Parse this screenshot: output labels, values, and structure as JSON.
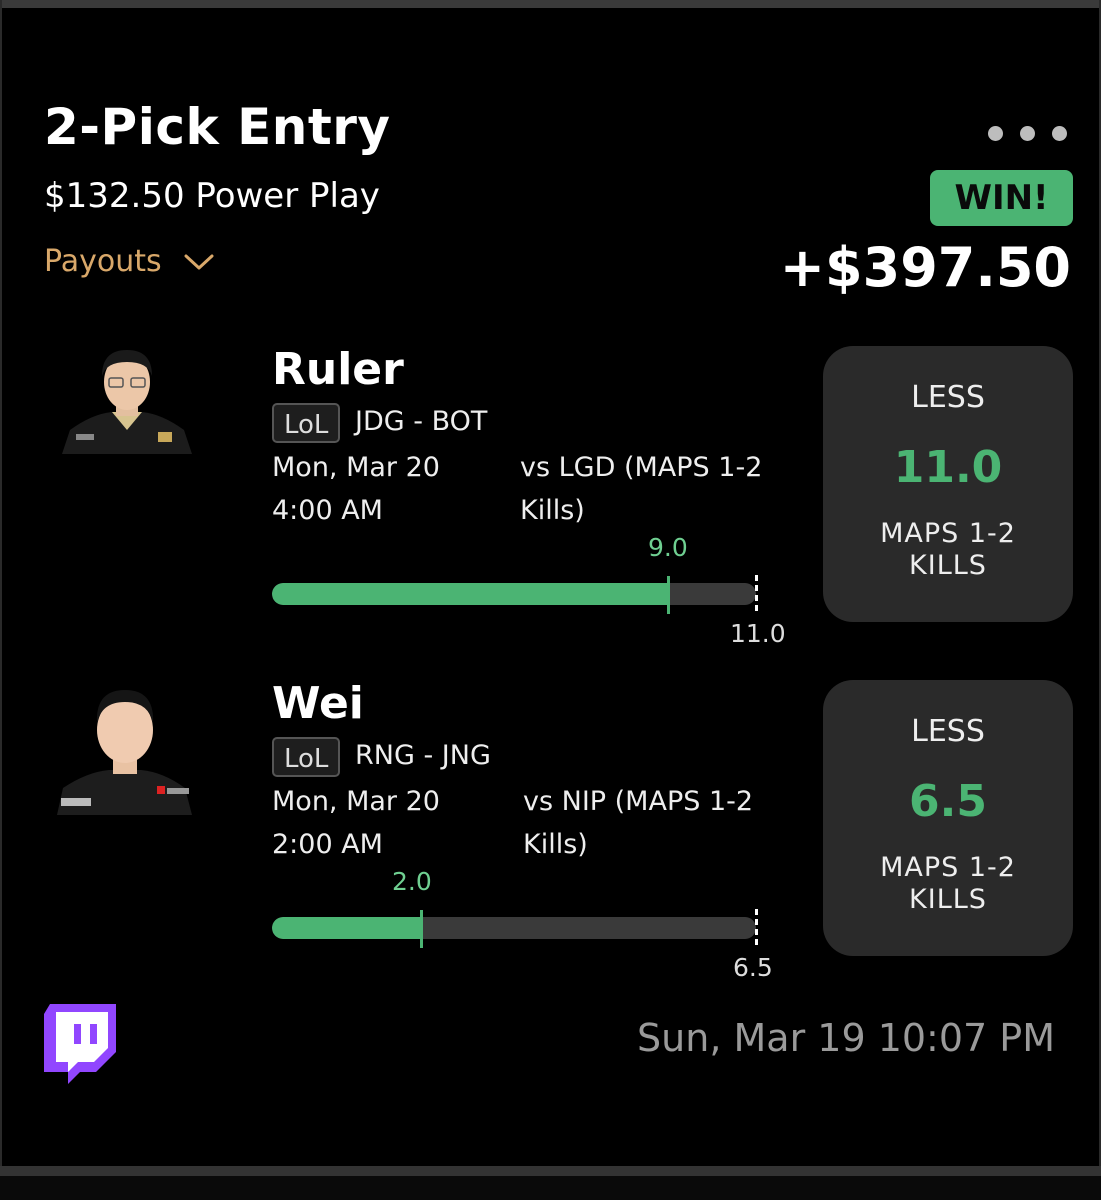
{
  "entry": {
    "title": "2-Pick Entry",
    "subtitle": "$132.50 Power Play",
    "payouts_label": "Payouts",
    "result_badge": "WIN!",
    "winnings": "+$397.50"
  },
  "picks": [
    {
      "player": "Ruler",
      "game_tag": "LoL",
      "team_position": "JDG - BOT",
      "schedule": "Mon, Mar 20 4:00 AM",
      "matchup": "vs LGD (MAPS 1-2 Kills)",
      "current_value": "9.0",
      "progress_fraction": 0.818,
      "target_value": "11.0",
      "direction": "LESS",
      "line": "11.0",
      "stat": "MAPS 1-2 KILLS"
    },
    {
      "player": "Wei",
      "game_tag": "LoL",
      "team_position": "RNG - JNG",
      "schedule": "Mon, Mar 20 2:00 AM",
      "matchup": "vs NIP (MAPS 1-2 Kills)",
      "current_value": "2.0",
      "progress_fraction": 0.308,
      "target_value": "6.5",
      "direction": "LESS",
      "line": "6.5",
      "stat": "MAPS 1-2 KILLS"
    }
  ],
  "footer": {
    "timestamp": "Sun, Mar 19 10:07 PM",
    "platform_icon": "twitch-icon"
  },
  "colors": {
    "accent_green": "#4bb473",
    "payouts_gold": "#d9a86a",
    "card_bg": "#2a2a2a",
    "twitch_purple": "#9146ff"
  }
}
